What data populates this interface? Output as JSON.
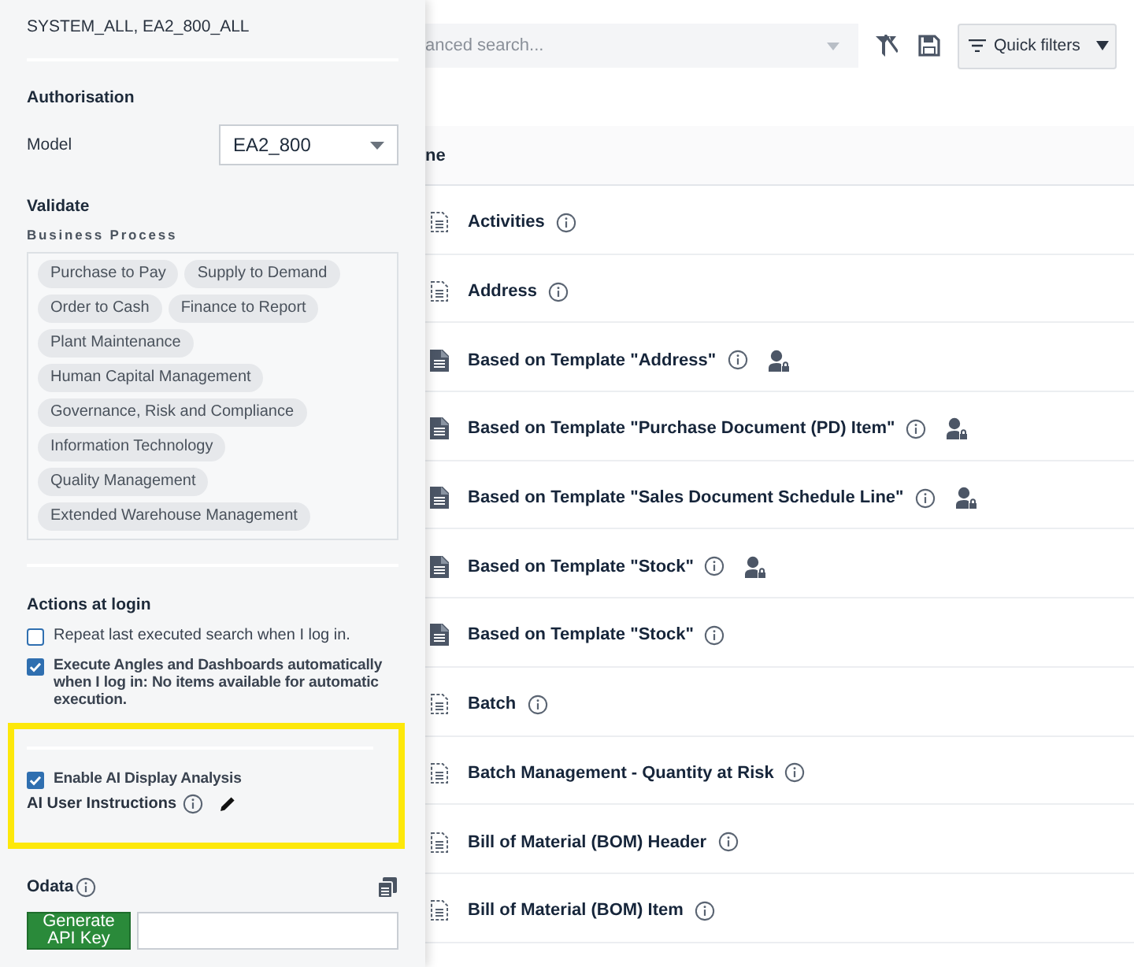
{
  "settings_panel": {
    "roles_text": "SYSTEM_ALL, EA2_800_ALL",
    "authorisation": {
      "heading": "Authorisation",
      "model_label": "Model",
      "model_value": "EA2_800"
    },
    "validate": {
      "heading": "Validate",
      "subheading": "Business Process",
      "tags": [
        "Purchase to Pay",
        "Supply to Demand",
        "Order to Cash",
        "Finance to Report",
        "Plant Maintenance",
        "Human Capital Management",
        "Governance, Risk and Compliance",
        "Information Technology",
        "Quality Management",
        "Extended Warehouse Management"
      ]
    },
    "actions_at_login": {
      "heading": "Actions at login",
      "options": [
        {
          "label": "Repeat last executed search when I log in.",
          "checked": false,
          "bold": false
        },
        {
          "label": "Execute Angles and Dashboards automatically when I log in: No items available for automatic execution.",
          "checked": true,
          "bold": true
        }
      ]
    },
    "ai": {
      "highlighted": true,
      "enable": {
        "label": "Enable AI Display Analysis",
        "checked": true
      },
      "instructions_label": "AI User Instructions"
    },
    "odata": {
      "heading": "Odata",
      "button": "Generate API Key"
    }
  },
  "main": {
    "search": {
      "placeholder": "anced search..."
    },
    "quick_filters": "Quick filters",
    "column_header": "ne",
    "rows": [
      {
        "name": "Activities",
        "kind": "dashed",
        "shared": false
      },
      {
        "name": "Address",
        "kind": "dashed",
        "shared": false
      },
      {
        "name": "Based on Template \"Address\"",
        "kind": "solid",
        "shared": true
      },
      {
        "name": "Based on Template \"Purchase Document (PD) Item\"",
        "kind": "solid",
        "shared": true
      },
      {
        "name": "Based on Template \"Sales Document Schedule Line\"",
        "kind": "solid",
        "shared": true
      },
      {
        "name": "Based on Template \"Stock\"",
        "kind": "solid",
        "shared": true
      },
      {
        "name": "Based on Template \"Stock\"",
        "kind": "solid",
        "shared": false
      },
      {
        "name": "Batch",
        "kind": "dashed",
        "shared": false
      },
      {
        "name": "Batch Management - Quantity at Risk",
        "kind": "dashed",
        "shared": false
      },
      {
        "name": "Bill of Material (BOM) Header",
        "kind": "dashed",
        "shared": false
      },
      {
        "name": "Bill of Material (BOM) Item",
        "kind": "dashed",
        "shared": false
      }
    ]
  }
}
